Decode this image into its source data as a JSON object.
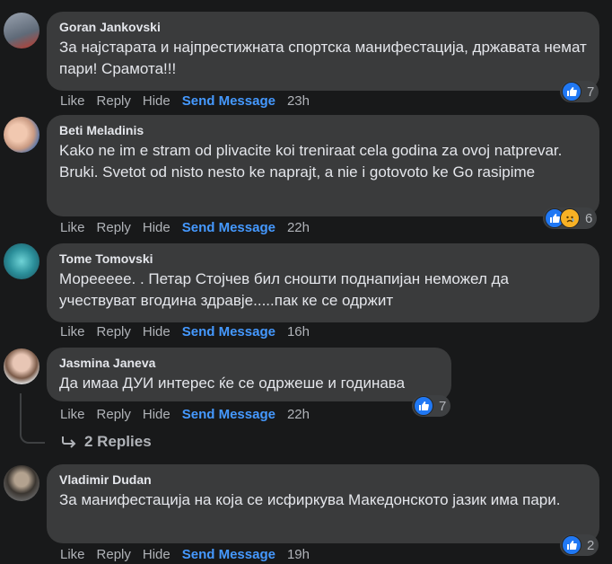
{
  "actions": {
    "like": "Like",
    "reply": "Reply",
    "hide": "Hide",
    "send": "Send Message"
  },
  "comments": [
    {
      "author": "Goran Jankovski",
      "text": "За најстарата и најпрестижната спортска манифестација, државата немат пари! Срамота!!!",
      "time": "23h",
      "reactions": "7"
    },
    {
      "author": "Beti Meladinis",
      "text": "Kako ne im e stram od plivacite koi treniraat cela godina za ovoj natprevar. Bruki. Svetot od nisto nesto ke naprajt, a nie i gotovoto ke Go rasipime",
      "time": "22h",
      "reactions": "6"
    },
    {
      "author": "Tome Tomovski",
      "text": "Мореееее. . Петар Стојчев бил сношти поднапијан неможел да учествуват вгодина здравје.....пак ке се одржит",
      "time": "16h",
      "reactions": ""
    },
    {
      "author": "Jasmina Janeva",
      "text": "Да имаа ДУИ интерес ќе се одржеше и годинава",
      "time": "22h",
      "reactions": "7"
    },
    {
      "author": "Vladimir Dudan",
      "text": "За манифестација на која се исфиркува Македонското јазик има пари.",
      "time": "19h",
      "reactions": "2"
    }
  ],
  "replies_label": "2 Replies"
}
